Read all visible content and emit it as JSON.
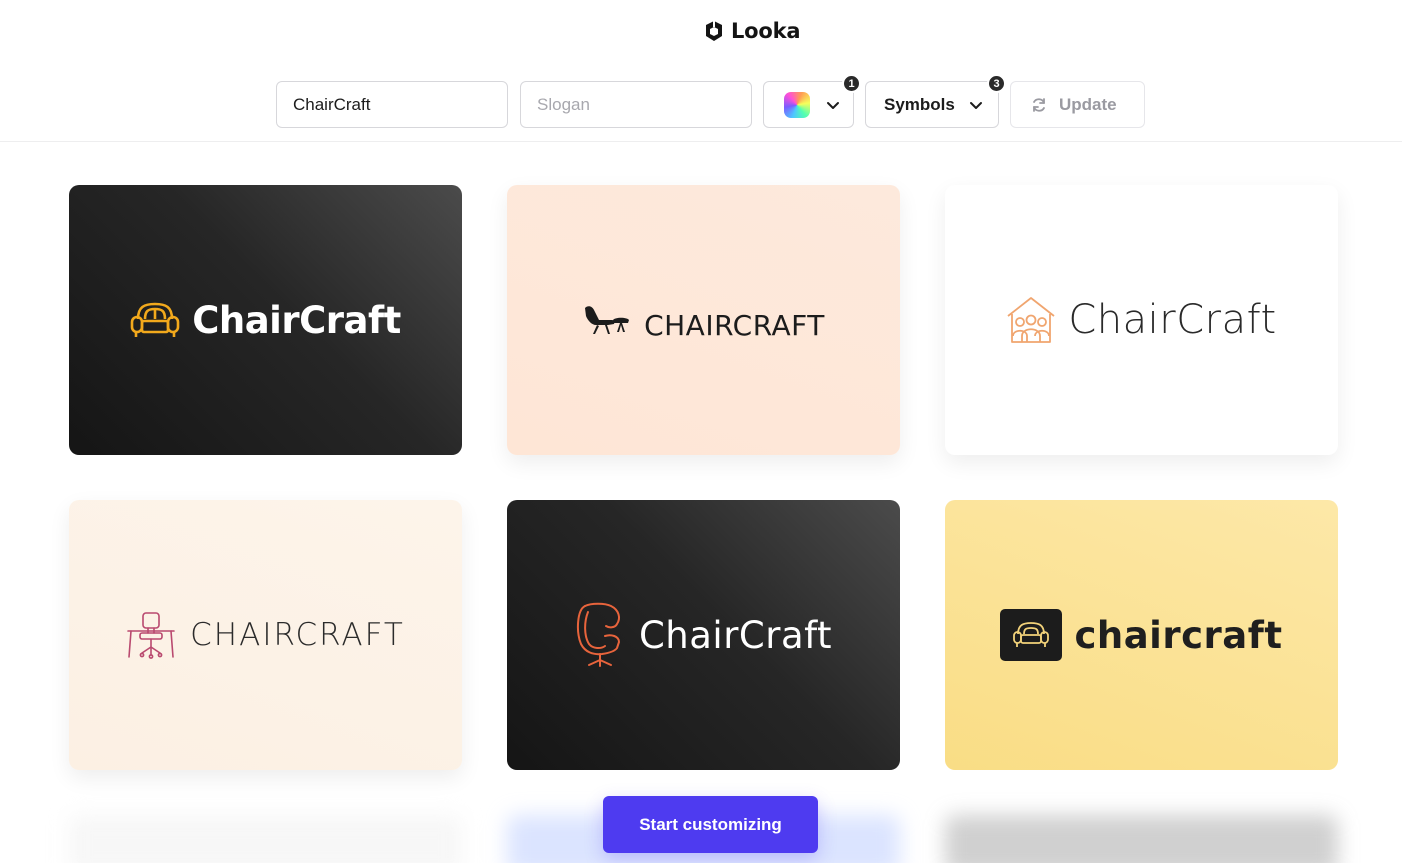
{
  "brand": {
    "name": "Looka"
  },
  "toolbar": {
    "company_name_value": "ChairCraft",
    "slogan_placeholder": "Slogan",
    "color_badge": "1",
    "symbols_label": "Symbols",
    "symbols_badge": "3",
    "update_label": "Update"
  },
  "logos": [
    {
      "text": "ChairCraft",
      "background": "dark",
      "icon": "armchair-icon",
      "accent": "#f2a91c"
    },
    {
      "text": "CHAIRCRAFT",
      "background": "peach",
      "icon": "lounge-chair-icon",
      "accent": "#1c1c1c"
    },
    {
      "text": "ChairCraft",
      "background": "white",
      "icon": "house-people-icon",
      "accent": "#f0a56f"
    },
    {
      "text": "CHAIRCRAFT",
      "background": "cream",
      "icon": "desk-chair-icon",
      "accent": "#b9496f"
    },
    {
      "text": "ChairCraft",
      "background": "dark",
      "icon": "egg-chair-icon",
      "accent": "#e8643c"
    },
    {
      "text": "chaircraft",
      "background": "yellow",
      "icon": "sofa-icon",
      "accent": "#f2d27a"
    }
  ],
  "cta": {
    "label": "Start customizing"
  },
  "colors": {
    "primary": "#4e3bf0"
  }
}
